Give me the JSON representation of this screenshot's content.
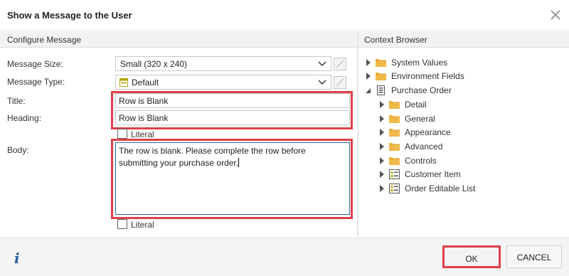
{
  "dialog": {
    "title": "Show a Message to the User"
  },
  "left_panel": {
    "header": "Configure Message"
  },
  "right_panel": {
    "header": "Context Browser"
  },
  "form": {
    "message_size": {
      "label": "Message Size:",
      "value": "Small (320 x 240)"
    },
    "message_type": {
      "label": "Message Type:",
      "value": "Default"
    },
    "title": {
      "label": "Title:",
      "value": "Row is Blank"
    },
    "heading": {
      "label": "Heading:",
      "value": "Row is Blank"
    },
    "heading_literal": {
      "label": "Literal",
      "checked": false
    },
    "body": {
      "label": "Body:",
      "value": "The row is blank. Please complete the row before submitting your purchase order."
    },
    "body_literal": {
      "label": "Literal",
      "checked": false
    }
  },
  "tree": [
    {
      "label": "System Values",
      "icon": "folder-icon",
      "expanded": false
    },
    {
      "label": "Environment Fields",
      "icon": "folder-icon",
      "expanded": false
    },
    {
      "label": "Purchase Order",
      "icon": "form-icon",
      "expanded": true
    },
    {
      "label": "Detail",
      "icon": "folder-icon",
      "expanded": false
    },
    {
      "label": "General",
      "icon": "folder-icon",
      "expanded": false
    },
    {
      "label": "Appearance",
      "icon": "folder-icon",
      "expanded": false
    },
    {
      "label": "Advanced",
      "icon": "folder-icon",
      "expanded": false
    },
    {
      "label": "Controls",
      "icon": "folder-icon",
      "expanded": false
    },
    {
      "label": "Customer Item",
      "icon": "item-icon",
      "expanded": false
    },
    {
      "label": "Order Editable List",
      "icon": "item-icon",
      "expanded": false
    }
  ],
  "footer": {
    "ok_label": "OK",
    "cancel_label": "CANCEL",
    "info_glyph": "i"
  },
  "colors": {
    "highlight": "#e0404a",
    "folder": "#f0b94a",
    "info": "#2a5aa0",
    "focus_border": "#2f5fa8"
  }
}
